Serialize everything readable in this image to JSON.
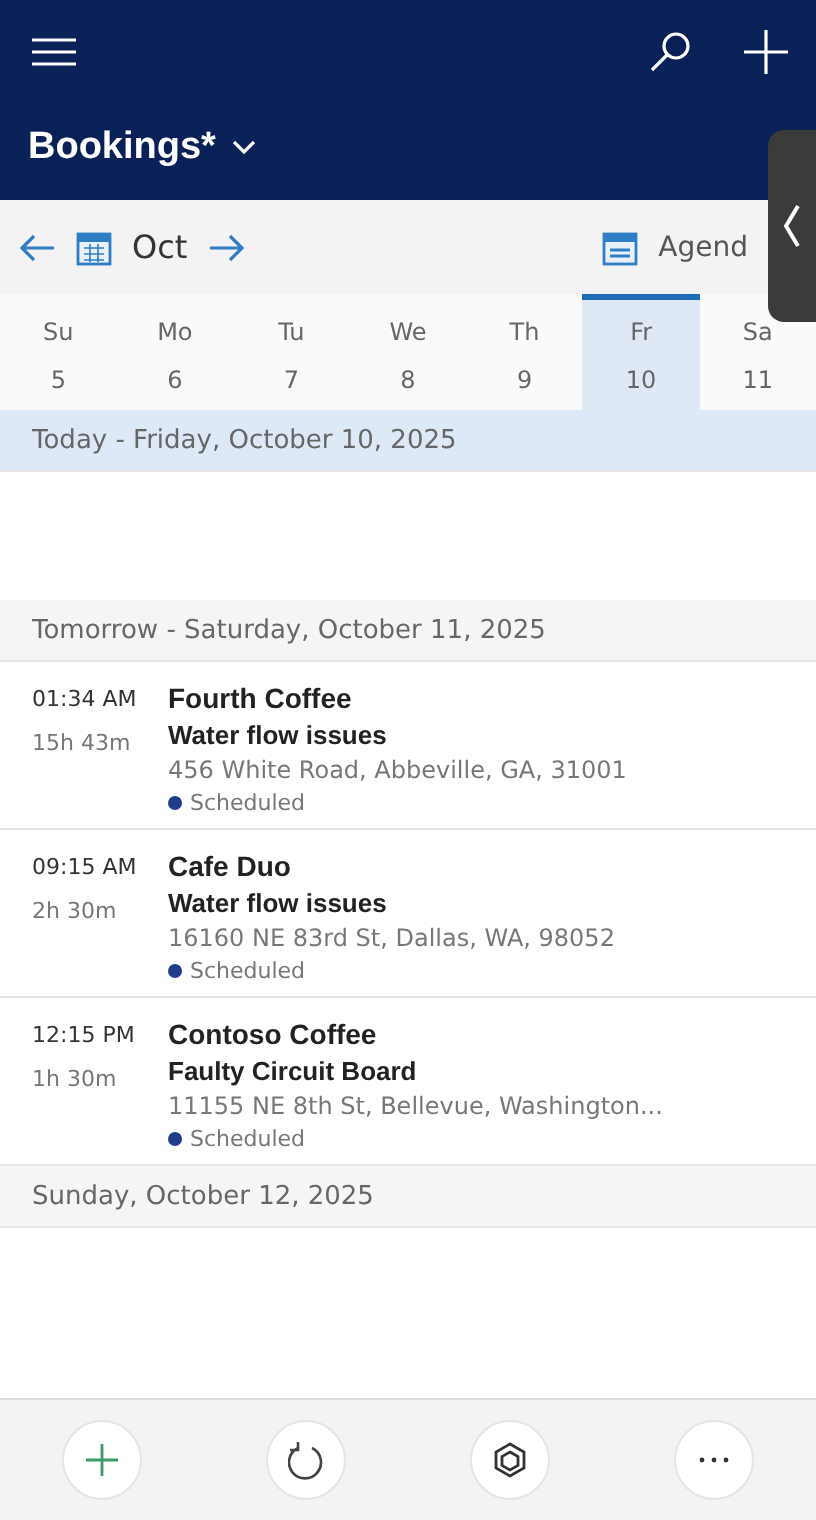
{
  "header": {
    "title": "Bookings*"
  },
  "toolbar": {
    "month": "Oct",
    "view": "Agend"
  },
  "week": [
    {
      "day": "Su",
      "date": "5",
      "selected": false
    },
    {
      "day": "Mo",
      "date": "6",
      "selected": false
    },
    {
      "day": "Tu",
      "date": "7",
      "selected": false
    },
    {
      "day": "We",
      "date": "8",
      "selected": false
    },
    {
      "day": "Th",
      "date": "9",
      "selected": false
    },
    {
      "day": "Fr",
      "date": "10",
      "selected": true
    },
    {
      "day": "Sa",
      "date": "11",
      "selected": false
    }
  ],
  "sections": [
    {
      "heading": "Today - Friday, October 10, 2025",
      "selected": true
    },
    {
      "heading": "Tomorrow - Saturday, October 11, 2025",
      "selected": false,
      "bookings": [
        {
          "time": "01:34 AM",
          "duration": "15h 43m",
          "customer": "Fourth Coffee",
          "issue": "Water flow issues",
          "address": "456 White Road, Abbeville, GA, 31001",
          "status": "Scheduled",
          "color": "#1f3d8a"
        },
        {
          "time": "09:15 AM",
          "duration": "2h 30m",
          "customer": "Cafe Duo",
          "issue": "Water flow issues",
          "address": "16160 NE 83rd St, Dallas, WA, 98052",
          "status": "Scheduled",
          "color": "#1f3d8a"
        },
        {
          "time": "12:15 PM",
          "duration": "1h 30m",
          "customer": "Contoso Coffee",
          "issue": "Faulty Circuit Board",
          "address": "11155 NE 8th St, Bellevue, Washington...",
          "status": "Scheduled",
          "color": "#1f3d8a"
        }
      ]
    },
    {
      "heading": "Sunday, October 12, 2025",
      "selected": false
    }
  ]
}
